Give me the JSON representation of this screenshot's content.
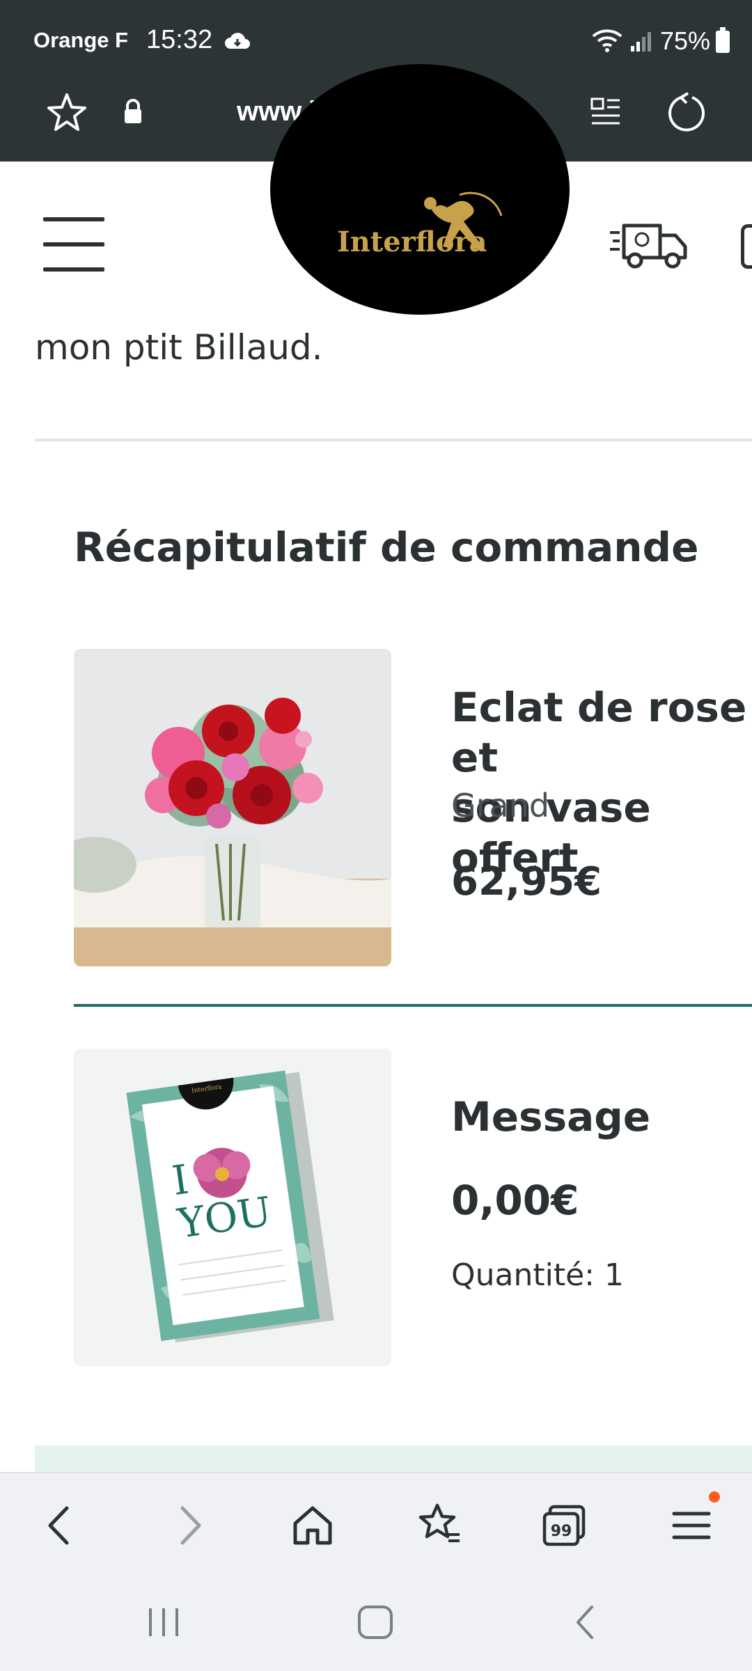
{
  "status_bar": {
    "carrier": "Orange F",
    "time": "15:32",
    "battery": "75%"
  },
  "browser": {
    "url": "www.interflora.fr"
  },
  "site": {
    "logo_text": "Interflora"
  },
  "content": {
    "recipient_message_tail": "mon ptit Billaud.",
    "summary_title": "Récapitulatif de commande",
    "items": [
      {
        "name": "Eclat de rose et\nson vase offert",
        "variant": "Grand",
        "price": "62,95€"
      },
      {
        "name": "Message",
        "price": "0,00€",
        "quantity": "Quantité: 1"
      }
    ]
  },
  "card_art": {
    "brand": "Interflora",
    "text_top": "I",
    "text_bottom": "YOU"
  },
  "colors": {
    "topbar": "#2d3436",
    "brand_gold": "#c7a24a",
    "separator_teal": "#1a6b66",
    "notification_dot": "#ff5a1f"
  }
}
